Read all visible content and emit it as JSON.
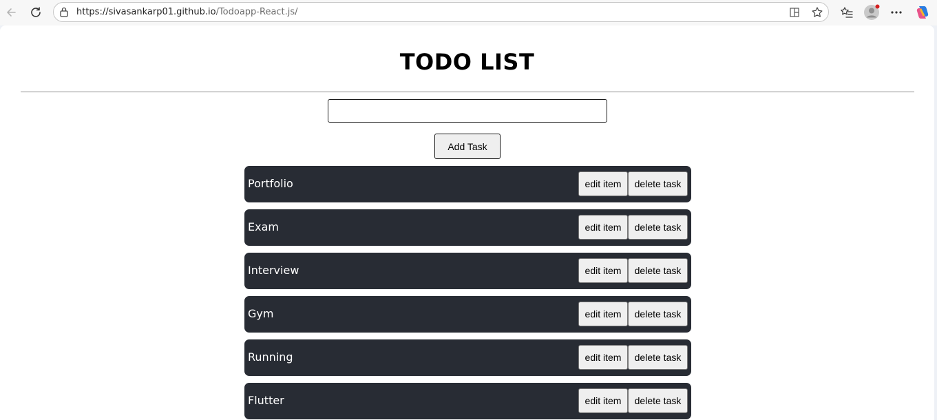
{
  "browser": {
    "url_host": "https://sivasankarp01.github.io",
    "url_path": "/Todoapp-React.js/",
    "icons": [
      "back-icon",
      "refresh-icon",
      "lock-icon",
      "split-screen-icon",
      "star-icon",
      "favorites-icon",
      "profile-icon",
      "more-icon",
      "copilot-icon"
    ]
  },
  "app": {
    "title": "TODO LIST",
    "input_value": "",
    "add_button_label": "Add Task",
    "edit_label": "edit item",
    "delete_label": "delete task",
    "tasks": [
      {
        "label": "Portfolio"
      },
      {
        "label": "Exam"
      },
      {
        "label": "Interview"
      },
      {
        "label": "Gym"
      },
      {
        "label": "Running"
      },
      {
        "label": "Flutter"
      }
    ]
  },
  "colors": {
    "task_row_bg": "#282c34",
    "task_text": "#ffffff",
    "button_bg": "#efefef",
    "browser_bg": "#f7f7f7"
  }
}
